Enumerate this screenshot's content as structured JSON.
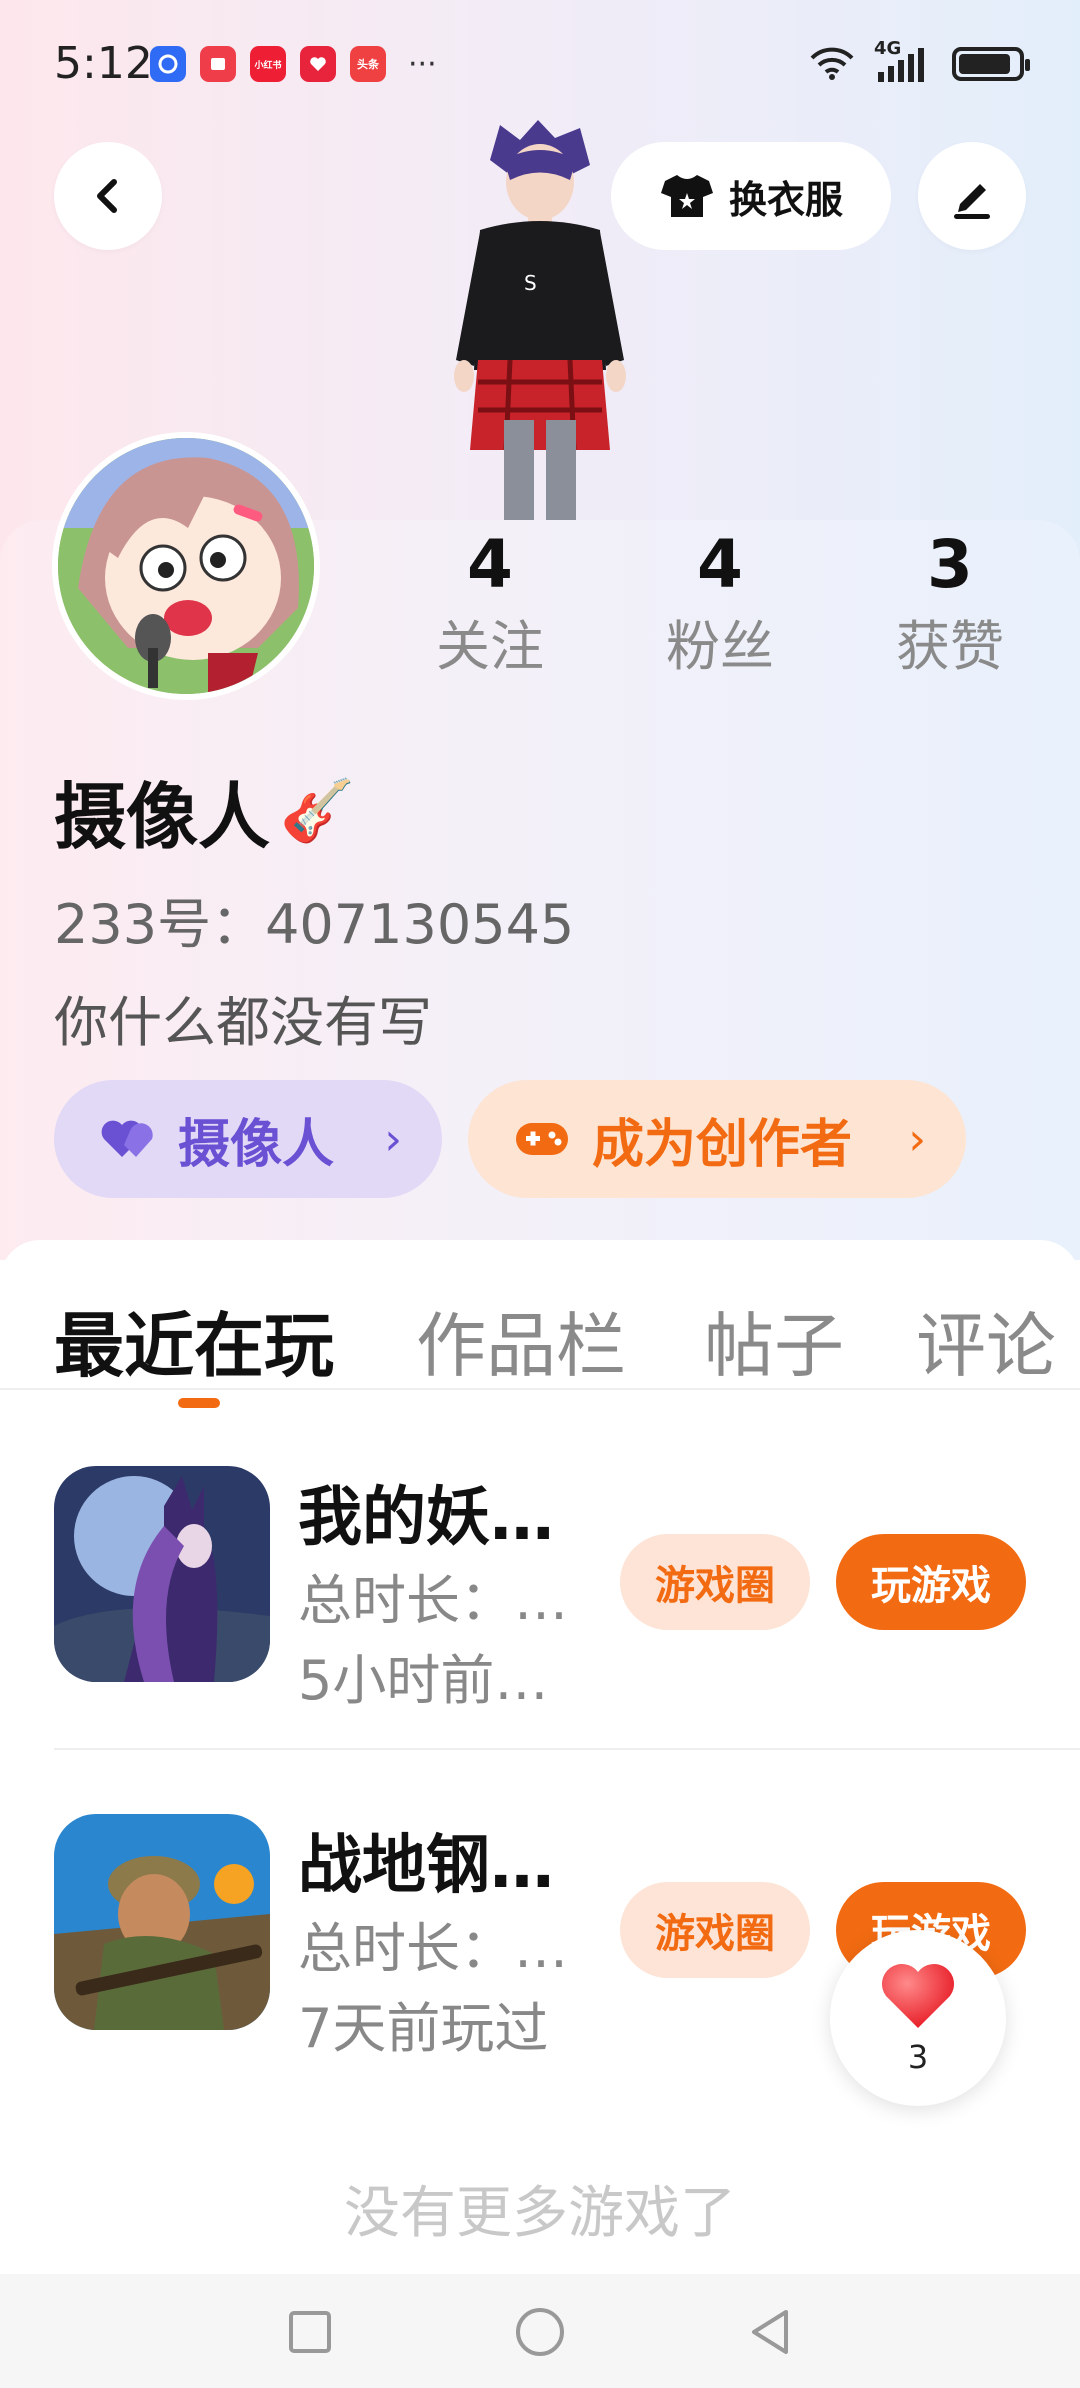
{
  "status_bar": {
    "time": "5:12",
    "app_icons": [
      {
        "name": "app-icon-1",
        "label": "",
        "color": "#2f6bf5"
      },
      {
        "name": "app-icon-2",
        "label": "",
        "color": "#ef3e4a"
      },
      {
        "name": "xiaohongshu-icon",
        "label": "小红书",
        "color": "#ee1e35"
      },
      {
        "name": "app-icon-4",
        "label": "",
        "color": "#e8243c"
      },
      {
        "name": "toutiao-icon",
        "label": "头条",
        "color": "#f04142"
      }
    ],
    "more": "···",
    "network": "4G"
  },
  "header": {
    "dress_up_label": "换衣服"
  },
  "profile": {
    "stats": [
      {
        "value": "4",
        "label": "关注"
      },
      {
        "value": "4",
        "label": "粉丝"
      },
      {
        "value": "3",
        "label": "获赞"
      }
    ],
    "nickname": "摄像人",
    "nickname_emoji": "🎸",
    "id_text": "233号：407130545",
    "bio": "你什么都没有写",
    "tag_purple": "摄像人",
    "tag_orange": "成为创作者",
    "chevron": "›"
  },
  "tabs": [
    {
      "label": "最近在玩",
      "active": true
    },
    {
      "label": "作品栏",
      "active": false
    },
    {
      "label": "帖子",
      "active": false
    },
    {
      "label": "评论",
      "active": false
    }
  ],
  "games": [
    {
      "title": "我的妖…",
      "playtime": "总时长：…",
      "last_played": "5小时前…",
      "circle_label": "游戏圈",
      "play_label": "玩游戏"
    },
    {
      "title": "战地钢…",
      "playtime": "总时长：…",
      "last_played": "7天前玩过",
      "circle_label": "游戏圈",
      "play_label": "玩游戏"
    }
  ],
  "no_more_text": "没有更多游戏了",
  "like_fab": {
    "count": "3"
  },
  "colors": {
    "accent": "#f26b12",
    "purple": "#6a50d3"
  }
}
